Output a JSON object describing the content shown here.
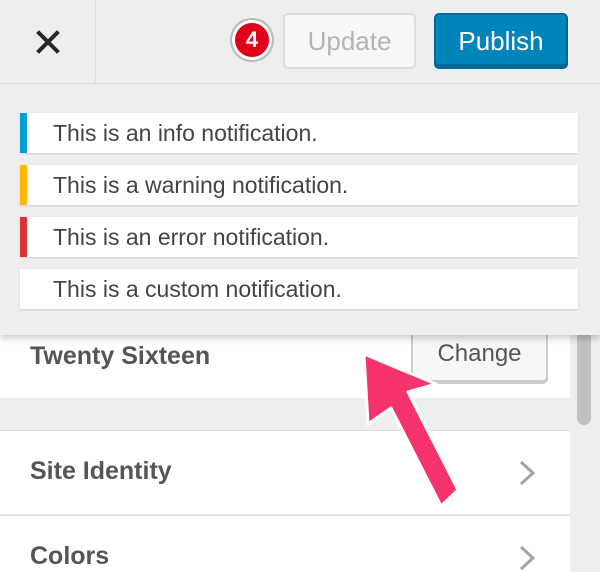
{
  "header": {
    "close_icon": "close-icon",
    "badge_count": "4",
    "update_label": "Update",
    "publish_label": "Publish"
  },
  "notifications": {
    "info": "This is an info notification.",
    "warning": "This is a warning notification.",
    "error": "This is an error notification.",
    "custom": "This is a custom notification."
  },
  "theme": {
    "name": "Twenty Sixteen",
    "change_label": "Change"
  },
  "sections": [
    {
      "label": "Site Identity",
      "icon": "chevron-right-icon"
    },
    {
      "label": "Colors",
      "icon": "chevron-right-icon"
    }
  ],
  "colors": {
    "info": "#00a0d2",
    "warning": "#ffb900",
    "error": "#dc3232",
    "publish": "#0085ba",
    "badge": "#e1001a",
    "annotation_arrow": "#f7336d"
  }
}
